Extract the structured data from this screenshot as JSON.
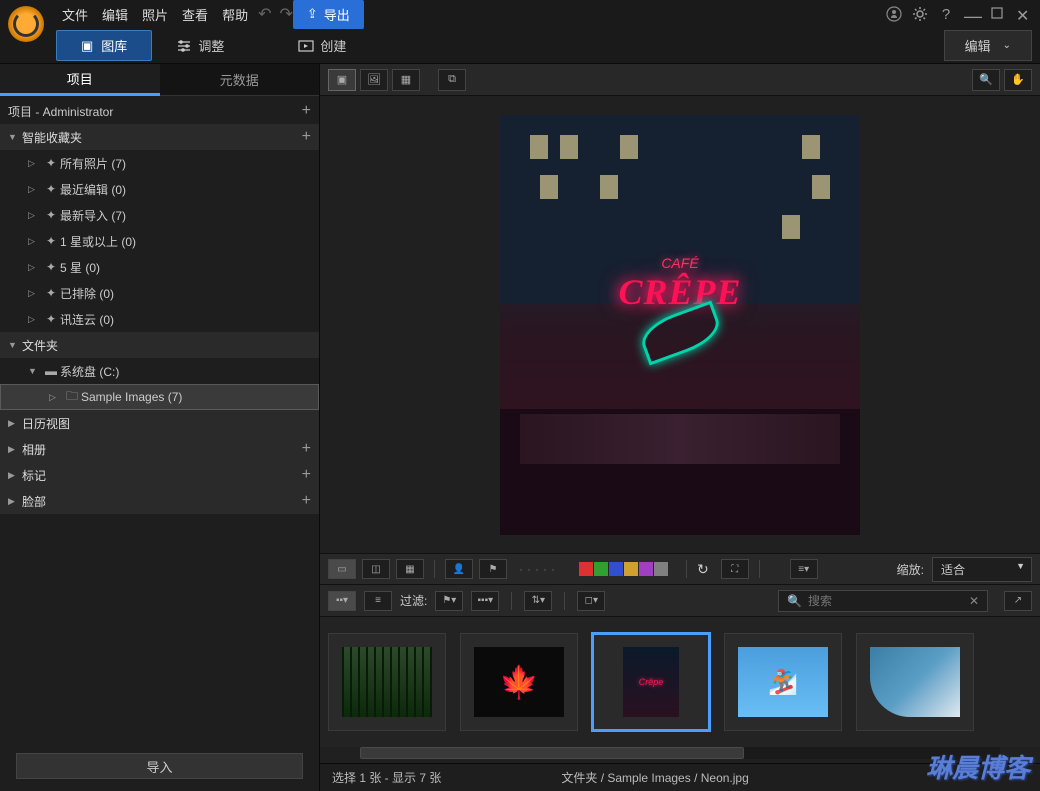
{
  "menu": {
    "file": "文件",
    "edit": "编辑",
    "photo": "照片",
    "view": "查看",
    "help": "帮助"
  },
  "toolbar": {
    "library": "图库",
    "adjust": "调整",
    "create": "创建",
    "export": "导出",
    "edit_drop": "编辑"
  },
  "side_tabs": {
    "project": "项目",
    "metadata": "元数据"
  },
  "tree": {
    "root": "项目 - Administrator",
    "smart": "智能收藏夹",
    "smart_items": [
      {
        "label": "所有照片",
        "count": "(7)"
      },
      {
        "label": "最近编辑",
        "count": "(0)"
      },
      {
        "label": "最新导入",
        "count": "(7)"
      },
      {
        "label": "1 星或以上",
        "count": "(0)"
      },
      {
        "label": "5 星",
        "count": "(0)"
      },
      {
        "label": "已排除",
        "count": "(0)"
      },
      {
        "label": "讯连云",
        "count": "(0)"
      }
    ],
    "folders": "文件夹",
    "sysdisk": "系统盘 (C:)",
    "sample": "Sample Images (7)",
    "calendar": "日历视图",
    "album": "相册",
    "tag": "标记",
    "face": "脸部"
  },
  "import_btn": "导入",
  "middle": {
    "zoom_label": "缩放:",
    "zoom_value": "适合"
  },
  "filter": {
    "label": "过滤:",
    "search_placeholder": "搜索"
  },
  "colors": [
    "#e03030",
    "#30a030",
    "#3050d0",
    "#d0a030",
    "#a040c0",
    "#808080"
  ],
  "status": {
    "selection": "选择 1 张 - 显示 7 张",
    "path": "文件夹 / Sample Images / Neon.jpg"
  },
  "watermark": "琳晨博客",
  "neon": {
    "cafe": "CAFÉ",
    "crepe": "CRÊPE"
  }
}
